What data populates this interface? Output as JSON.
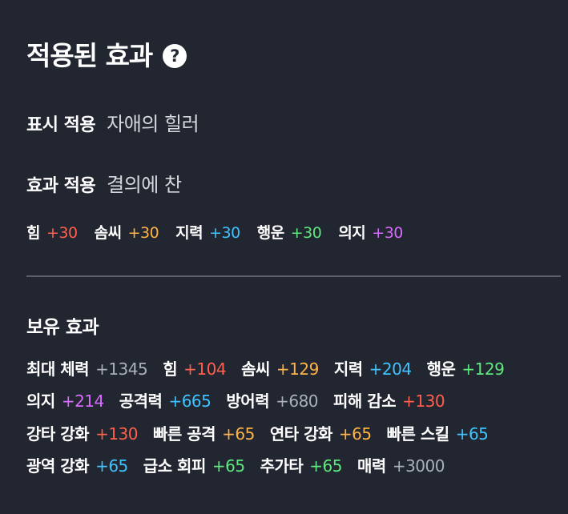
{
  "title": "적용된 효과",
  "help_icon": "question-circle-icon",
  "display_applied": {
    "label": "표시 적용",
    "value": "자애의 힐러"
  },
  "effect_applied": {
    "label": "효과 적용",
    "value": "결의에 찬"
  },
  "applied_stats": [
    {
      "name": "힘",
      "value": "+30",
      "color": "#ff5f4c"
    },
    {
      "name": "솜씨",
      "value": "+30",
      "color": "#ffb347"
    },
    {
      "name": "지력",
      "value": "+30",
      "color": "#3fc3ff"
    },
    {
      "name": "행운",
      "value": "+30",
      "color": "#5ee87e"
    },
    {
      "name": "의지",
      "value": "+30",
      "color": "#d86bff"
    }
  ],
  "owned": {
    "title": "보유 효과",
    "lines": [
      [
        {
          "name": "최대 체력",
          "value": "+1345",
          "color": "#aab0bb"
        },
        {
          "name": "힘",
          "value": "+104",
          "color": "#ff5f4c"
        },
        {
          "name": "솜씨",
          "value": "+129",
          "color": "#ffb347"
        },
        {
          "name": "지력",
          "value": "+204",
          "color": "#3fc3ff"
        },
        {
          "name": "행운",
          "value": "+129",
          "color": "#5ee87e"
        }
      ],
      [
        {
          "name": "의지",
          "value": "+214",
          "color": "#d86bff"
        },
        {
          "name": "공격력",
          "value": "+665",
          "color": "#3fc3ff"
        },
        {
          "name": "방어력",
          "value": "+680",
          "color": "#aab0bb"
        },
        {
          "name": "피해 감소",
          "value": "+130",
          "color": "#ff5f4c"
        }
      ],
      [
        {
          "name": "강타 강화",
          "value": "+130",
          "color": "#ff5f4c"
        },
        {
          "name": "빠른 공격",
          "value": "+65",
          "color": "#ffb347"
        },
        {
          "name": "연타 강화",
          "value": "+65",
          "color": "#ffb347"
        },
        {
          "name": "빠른 스킬",
          "value": "+65",
          "color": "#3fc3ff"
        }
      ],
      [
        {
          "name": "광역 강화",
          "value": "+65",
          "color": "#3fc3ff"
        },
        {
          "name": "급소 회피",
          "value": "+65",
          "color": "#5ee87e"
        },
        {
          "name": "추가타",
          "value": "+65",
          "color": "#5ee87e"
        },
        {
          "name": "매력",
          "value": "+3000",
          "color": "#aab0bb"
        }
      ]
    ]
  }
}
